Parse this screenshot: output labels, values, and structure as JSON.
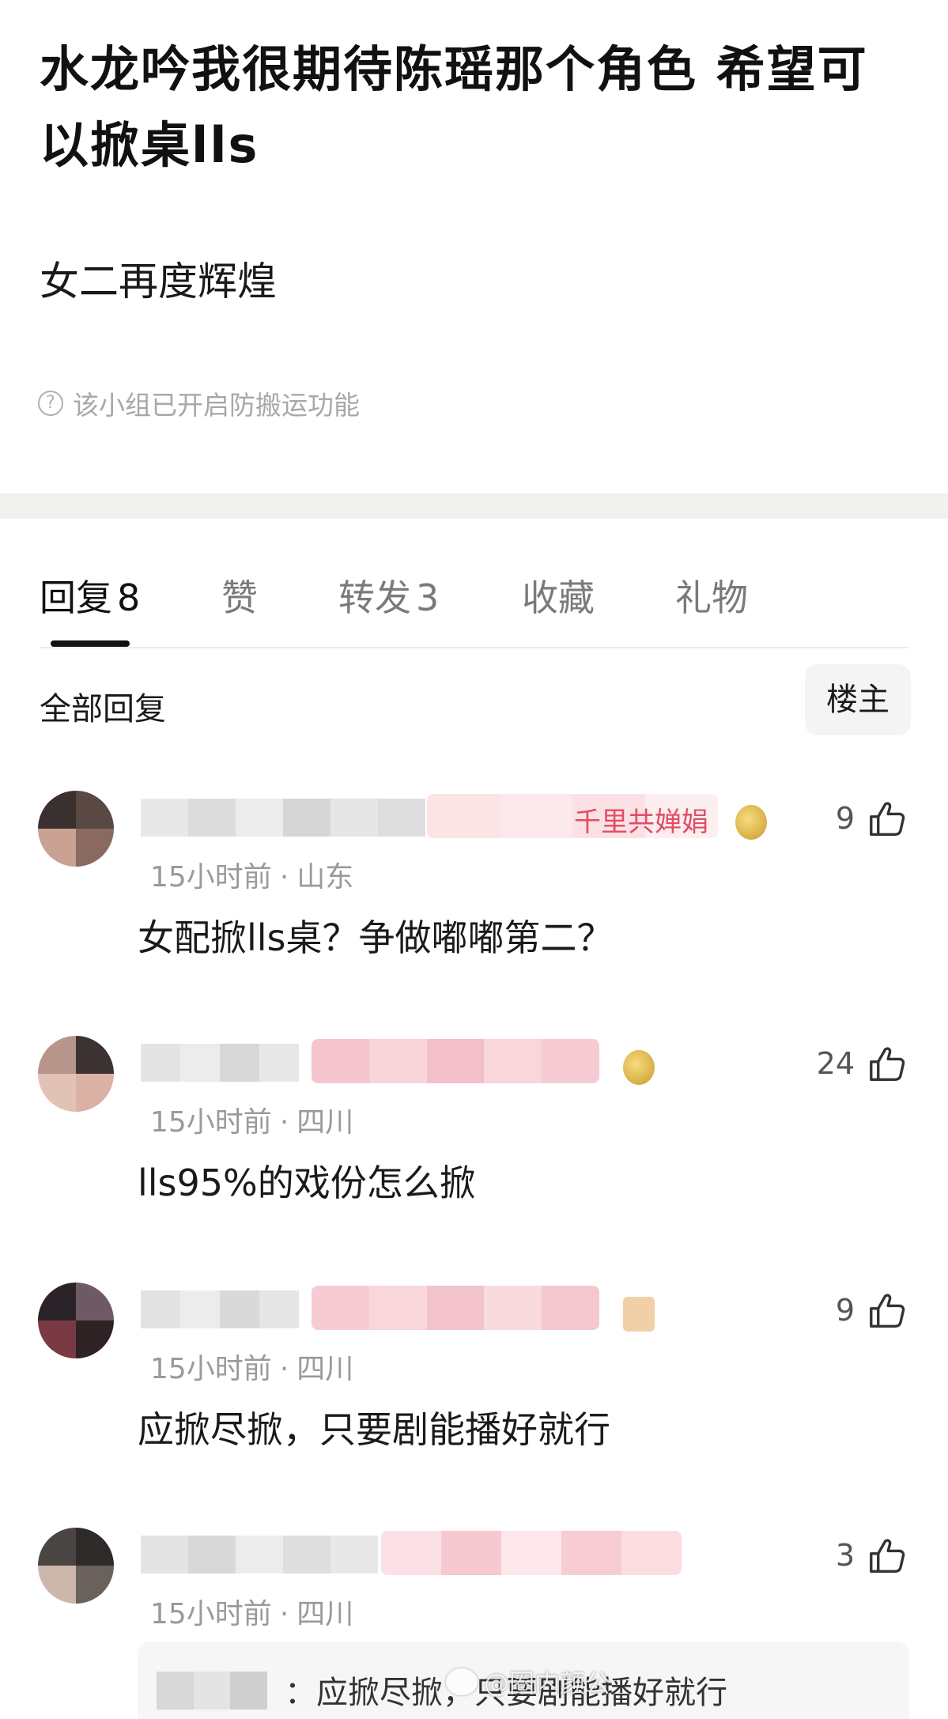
{
  "post": {
    "title": "水龙吟我很期待陈瑶那个角色 希望可以掀桌lls",
    "body": "女二再度辉煌",
    "notice": "该小组已开启防搬运功能",
    "notice_icon": "question-circle-icon"
  },
  "tabs": [
    {
      "label": "回复",
      "count": "8",
      "active": true
    },
    {
      "label": "赞",
      "count": "",
      "active": false
    },
    {
      "label": "转发",
      "count": "3",
      "active": false
    },
    {
      "label": "收藏",
      "count": "",
      "active": false
    },
    {
      "label": "礼物",
      "count": "",
      "active": false
    }
  ],
  "filter": {
    "label": "全部回复",
    "op_button": "楼主"
  },
  "comments": [
    {
      "time": "15小时前",
      "location": "山东",
      "content": "女配掀lls桌？争做嘟嘟第二？",
      "likes": "9",
      "badge_text": "千里共婵娟"
    },
    {
      "time": "15小时前",
      "location": "四川",
      "content": "lls95%的戏份怎么掀",
      "likes": "24"
    },
    {
      "time": "15小时前",
      "location": "四川",
      "content": "应掀尽掀，只要剧能播好就行",
      "likes": "9"
    },
    {
      "time": "15小时前",
      "location": "四川",
      "content": "",
      "likes": "3"
    }
  ],
  "quote": {
    "text": "：应掀尽掀，只要剧能播好就行"
  },
  "watermark": "@圈内颜公",
  "colors": {
    "accent_pink": "#e04d63",
    "divider": "#f1f1ef",
    "muted_text": "#9a9a9a"
  },
  "meta_separator": "·"
}
